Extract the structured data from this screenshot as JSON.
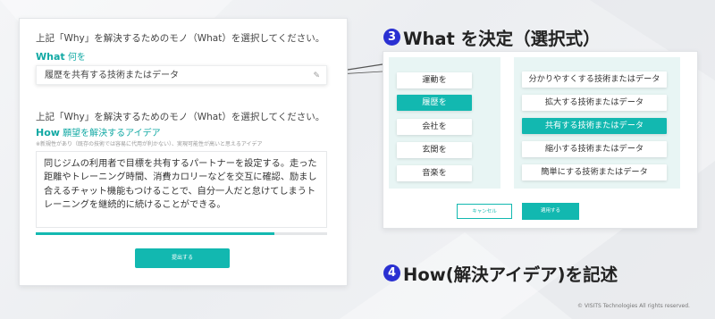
{
  "colors": {
    "accent": "#12b8b0",
    "step_circle": "#2a30d2",
    "option_bg": "#e8f5f4"
  },
  "form": {
    "what_question": "上記「Why」を解決するためのモノ（What）を選択してください。",
    "what_label_bold": "What",
    "what_label_sub": "何を",
    "what_value": "履歴を共有する技術またはデータ",
    "how_question": "上記「Why」を解決するためのモノ（What）を選択してください。",
    "how_label_bold": "How",
    "how_label_sub": "願望を解決するアイデア",
    "how_hint": "※新規性があり（既存の技術では容易に代用が利かない）、実現可能性が高いと思えるアイデア",
    "how_text": "同じジムの利用者で目標を共有するパートナーを設定する。走った距離やトレーニング時間、消費カロリーなどを交互に確認、励まし合えるチャット機能もつけることで、自分一人だと怠けてしまうトレーニングを継続的に続けることができる。",
    "progress_fraction": 0.82,
    "submit_label": "提出する"
  },
  "step3": {
    "number": "3",
    "title": "What を決定（選択式）"
  },
  "step4": {
    "number": "4",
    "title": "How(解決アイデア)を記述"
  },
  "modal": {
    "verbs": [
      {
        "label": "運動を",
        "selected": false
      },
      {
        "label": "履歴を",
        "selected": true
      },
      {
        "label": "会社を",
        "selected": false
      },
      {
        "label": "玄関を",
        "selected": false
      },
      {
        "label": "音楽を",
        "selected": false
      }
    ],
    "nouns": [
      {
        "label": "分かりやすくする技術またはデータ",
        "selected": false
      },
      {
        "label": "拡大する技術またはデータ",
        "selected": false
      },
      {
        "label": "共有する技術またはデータ",
        "selected": true
      },
      {
        "label": "縮小する技術またはデータ",
        "selected": false
      },
      {
        "label": "簡単にする技術またはデータ",
        "selected": false
      }
    ],
    "cancel_label": "キャンセル",
    "apply_label": "適用する"
  },
  "copyright": "© VISITS Technologies  All rights reserved."
}
